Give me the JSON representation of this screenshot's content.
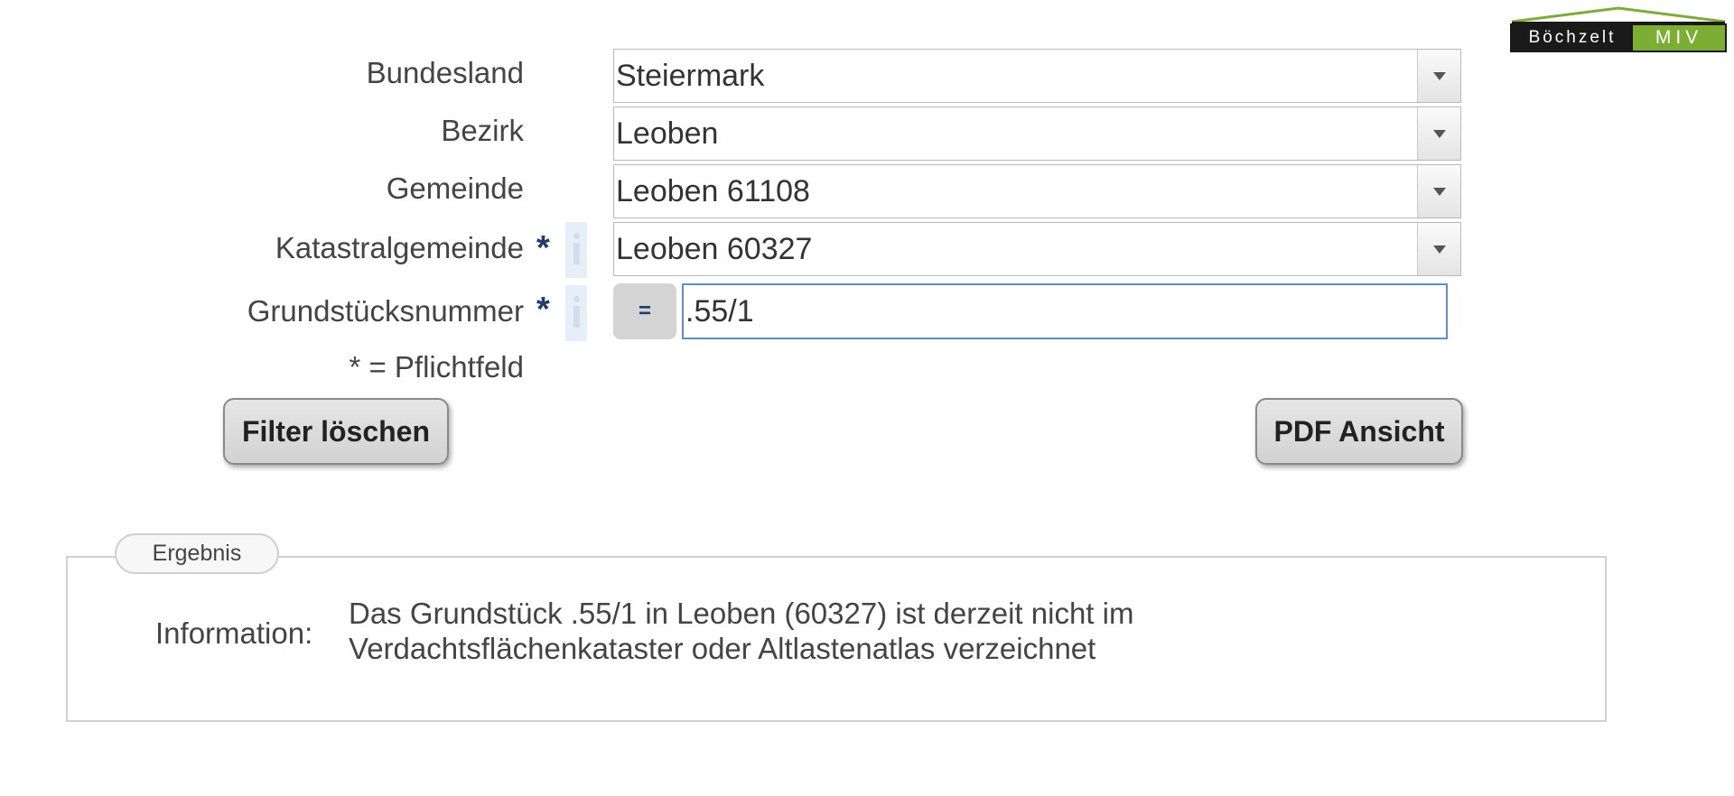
{
  "logo": {
    "left_text": "Böchzelt",
    "right_text": "MIV",
    "colors": {
      "dark": "#1a1a1a",
      "green": "#7cae34"
    }
  },
  "form": {
    "fields": [
      {
        "label": "Bundesland",
        "value": "Steiermark",
        "required": false
      },
      {
        "label": "Bezirk",
        "value": "Leoben",
        "required": false
      },
      {
        "label": "Gemeinde",
        "value": "Leoben 61108",
        "required": false
      },
      {
        "label": "Katastralgemeinde",
        "value": "Leoben 60327",
        "required": true,
        "info_icon": "info-icon"
      }
    ],
    "parcel": {
      "label": "Grundstücksnummer",
      "required_marker": "*",
      "operator": "=",
      "value": ".55/1",
      "info_icon": "info-icon"
    },
    "required_marker": "*",
    "required_hint": "* = Pflichtfeld"
  },
  "buttons": {
    "clear": "Filter löschen",
    "pdf": "PDF Ansicht"
  },
  "result": {
    "legend": "Ergebnis",
    "label": "Information:",
    "line1": "Das Grundstück .55/1 in Leoben (60327) ist derzeit nicht im",
    "line2": "Verdachtsflächenkataster oder Altlastenatlas verzeichnet"
  },
  "colors": {
    "accent_star": "#1f3d6e",
    "input_focus_border": "#5b8fd1"
  }
}
